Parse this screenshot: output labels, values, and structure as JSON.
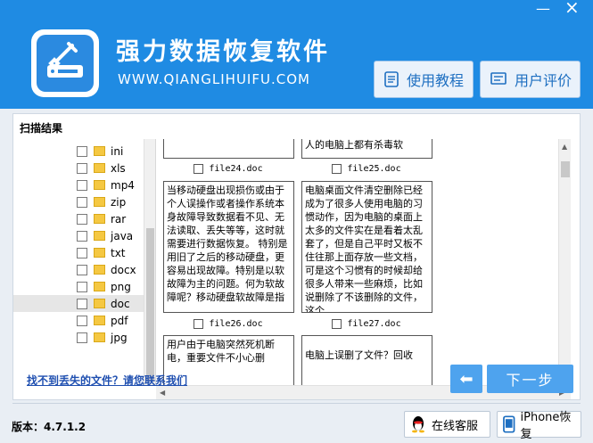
{
  "header": {
    "title": "强力数据恢复软件",
    "url": "WWW.QIANGLIHUIFU.COM",
    "tutorial_btn": "使用教程",
    "review_btn": "用户评价",
    "minimize": "—",
    "close": "×"
  },
  "scan": {
    "title": "扫描结果"
  },
  "tree": {
    "items": [
      "ini",
      "xls",
      "mp4",
      "zip",
      "rar",
      "java",
      "txt",
      "docx",
      "png",
      "doc",
      "pdf",
      "jpg"
    ],
    "selected": "doc"
  },
  "files": {
    "top_right_text": "人的电脑上都有杀毒软",
    "name1": "file24.doc",
    "name2": "file25.doc",
    "name3": "file26.doc",
    "name4": "file27.doc",
    "content1": "当移动硬盘出现损伤或由于个人误操作或者操作系统本身故障导致数据看不见、无法读取、丢失等等，这时就需要进行数据恢复。 特别是用旧了之后的移动硬盘，更容易出现故障。特别是以软故障为主的问题。何为软故障呢？移动硬盘软故障是指",
    "content2": "电脑桌面文件清空删除已经成为了很多人使用电脑的习惯动作，因为电脑的桌面上太多的文件实在是看着太乱套了，但是自己平时又板不住往那上面存放一些文档，可是这个习惯有的时候却给很多人带来一些麻烦，比如说删除了不该删除的文件，这个",
    "content3": "用户由于电脑突然死机断电，重要文件不小心删",
    "content4": "电脑上误删了文件？回收"
  },
  "footer": {
    "contact_link": "找不到丢失的文件？请您联系我们",
    "back_arrow": "⬅",
    "next": "下一步",
    "version": "版本：4.7.1.2",
    "service_btn": "在线客服",
    "iphone_btn": "iPhone恢复"
  },
  "colors": {
    "brand": "#1f8be3",
    "button": "#4ea3ee",
    "link": "#1f4fb0"
  }
}
